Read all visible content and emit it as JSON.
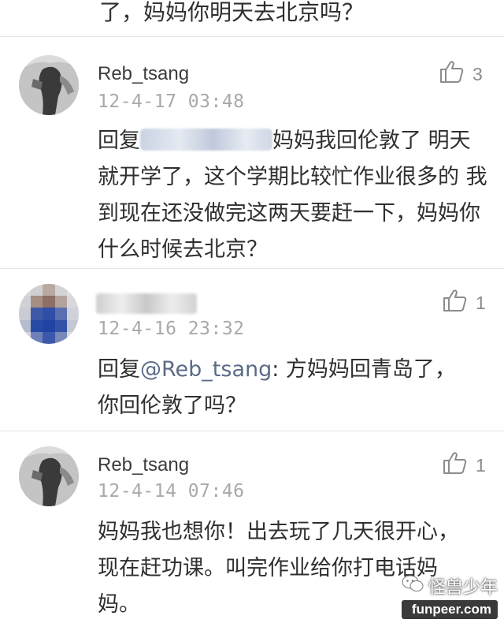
{
  "top_text": "了，妈妈你明天去北京吗？",
  "comments": [
    {
      "username": "Reb_tsang",
      "time": "12-4-17 03:48",
      "likes": "3",
      "reply_prefix": "回复",
      "body_line1_tail": "妈妈我回伦敦了 明",
      "body_rest": "天就开学了，这个学期比较忙作业很多的 我到现在还没做完这两天要赶一下，妈妈你什么时候去北京？"
    },
    {
      "time": "12-4-16 23:32",
      "likes": "1",
      "reply_prefix": "回复",
      "mention": "@Reb_tsang",
      "body_line1_tail": ": 方妈妈回青岛了，",
      "body_rest": "你回伦敦了吗？"
    },
    {
      "username": "Reb_tsang",
      "time": "12-4-14 07:46",
      "likes": "1",
      "body": "妈妈我也想你！出去玩了几天很开心，现在赶功课。叫完作业给你打电话妈妈。"
    }
  ],
  "watermark": {
    "name": "怪兽少年",
    "site": "funpeer.com"
  },
  "colors": {
    "mention": "#5b6b87",
    "time": "#a9a9a9",
    "divider": "#e3e3e3"
  }
}
